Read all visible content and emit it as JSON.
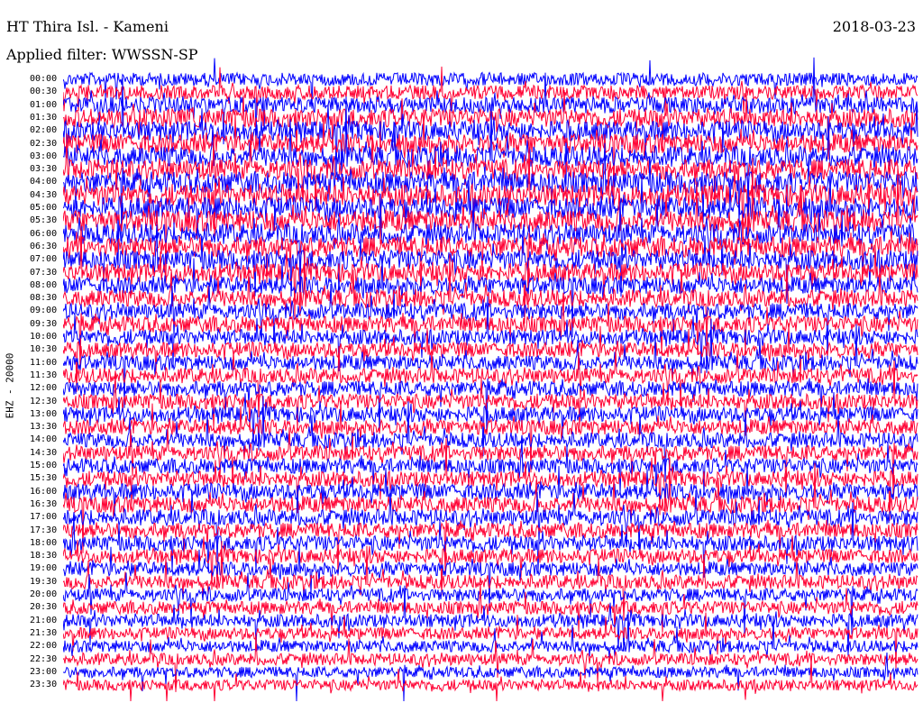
{
  "header": {
    "station": "HT Thira Isl. - Kameni",
    "date": "2018-03-23",
    "filter": "Applied filter: WWSSN-SP"
  },
  "channel_label": "EHZ - 20000",
  "chart_data": {
    "type": "line",
    "title": "HT Thira Isl. - Kameni",
    "date": "2018-03-23",
    "filter": "WWSSN-SP",
    "ylabel": "EHZ - 20000",
    "trace_interval_minutes": 30,
    "row_labels": [
      "00:00",
      "00:30",
      "01:00",
      "01:30",
      "02:00",
      "02:30",
      "03:00",
      "03:30",
      "04:00",
      "04:30",
      "05:00",
      "05:30",
      "06:00",
      "06:30",
      "07:00",
      "07:30",
      "08:00",
      "08:30",
      "09:00",
      "09:30",
      "10:00",
      "10:30",
      "11:00",
      "11:30",
      "12:00",
      "12:30",
      "13:00",
      "13:30",
      "14:00",
      "14:30",
      "15:00",
      "15:30",
      "16:00",
      "16:30",
      "17:00",
      "17:30",
      "18:00",
      "18:30",
      "19:00",
      "19:30",
      "20:00",
      "20:30",
      "21:00",
      "21:30",
      "22:00",
      "22:30",
      "23:00",
      "23:30"
    ],
    "series_colors": [
      "#0000ff",
      "#ff0033"
    ],
    "relative_amplitude": [
      1.2,
      1.3,
      1.5,
      1.7,
      1.8,
      1.8,
      1.9,
      1.9,
      2.0,
      2.0,
      2.0,
      2.0,
      1.9,
      1.9,
      1.8,
      1.7,
      1.6,
      1.6,
      1.5,
      1.5,
      1.4,
      1.4,
      1.4,
      1.4,
      1.4,
      1.4,
      1.4,
      1.4,
      1.4,
      1.4,
      1.4,
      1.4,
      1.5,
      1.5,
      1.5,
      1.4,
      1.4,
      1.3,
      1.3,
      1.3,
      1.2,
      1.2,
      1.2,
      1.1,
      1.1,
      1.1,
      1.0,
      1.0
    ]
  }
}
